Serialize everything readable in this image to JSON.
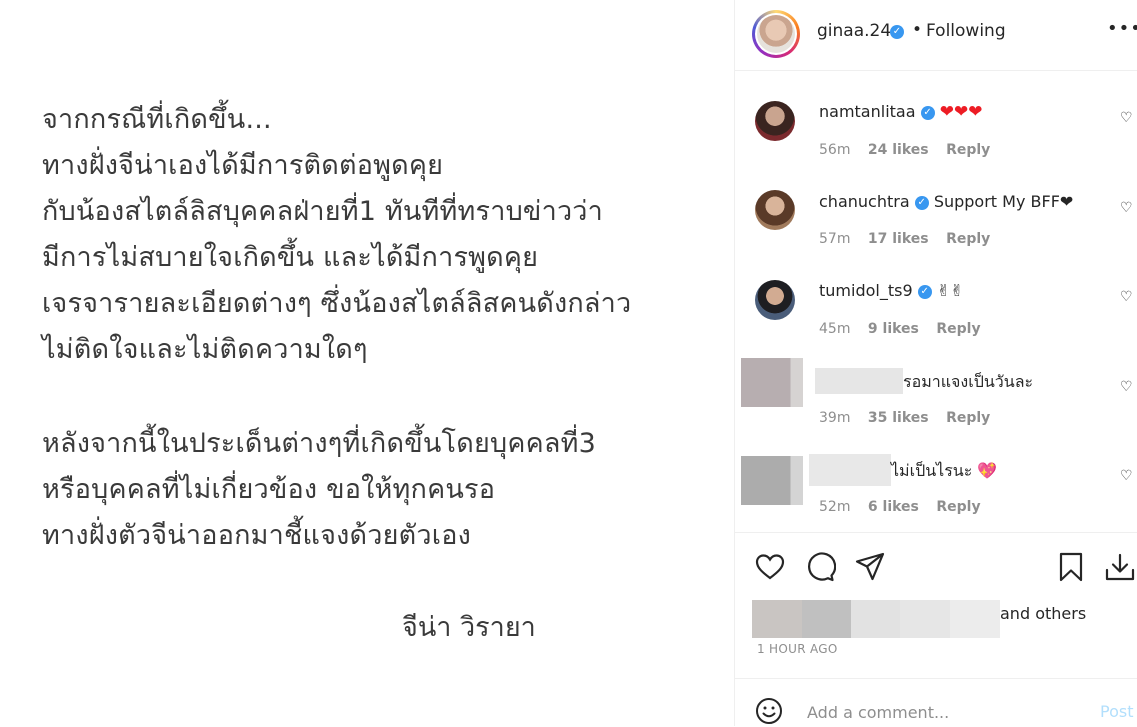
{
  "post": {
    "lines": [
      "จากกรณีที่เกิดขึ้น...",
      "ทางฝั่งจีน่าเองได้มีการติดต่อพูดคุย",
      "กับน้องสไตล์ลิสบุคคลฝ่ายที่1 ทันทีที่ทราบข่าวว่า",
      "มีการไม่สบายใจเกิดขึ้น และได้มีการพูดคุย",
      "เจรจารายละเอียดต่างๆ ซึ่งน้องสไตล์ลิสคนดังกล่าว",
      "ไม่ติดใจและไม่ติดความใดๆ",
      "หลังจากนี้ในประเด็นต่างๆที่เกิดขึ้นโดยบุคคลที่3",
      "หรือบุคคลที่ไม่เกี่ยวข้อง ขอให้ทุกคนรอ",
      "ทางฝั่งตัวจีน่าออกมาชี้แจงด้วยตัวเอง"
    ],
    "signature": "จีน่า วิรายา"
  },
  "header": {
    "username": "ginaa.24",
    "separator": "•",
    "following": "Following",
    "more": "•••"
  },
  "comments": [
    {
      "username": "namtanlitaa",
      "verified": true,
      "text": "❤❤❤",
      "time": "56m",
      "likes": "24 likes",
      "reply": "Reply"
    },
    {
      "username": "chanuchtra",
      "verified": true,
      "text": "Support My BFF❤",
      "time": "57m",
      "likes": "17 likes",
      "reply": "Reply"
    },
    {
      "username": "tumidol_ts9",
      "verified": true,
      "text": "✌✌",
      "time": "45m",
      "likes": "9 likes",
      "reply": "Reply"
    },
    {
      "username": "",
      "verified": false,
      "text": "รอมาแจงเป็นวันละ",
      "time": "39m",
      "likes": "35 likes",
      "reply": "Reply"
    },
    {
      "username": "",
      "verified": false,
      "text": "ไม่เป็นไรนะ 💖",
      "time": "52m",
      "likes": "6 likes",
      "reply": "Reply"
    }
  ],
  "actions": {
    "likes_text": "and others",
    "time": "1 HOUR AGO"
  },
  "add_comment": {
    "placeholder": "Add a comment...",
    "post_label": "Post"
  },
  "icons": {
    "like": "heart-icon",
    "comment": "comment-icon",
    "share": "send-icon",
    "save": "bookmark-icon",
    "download": "download-icon",
    "emoji": "smile-icon",
    "verified": "verified-badge-icon"
  },
  "colors": {
    "verified": "#3897f0",
    "heart_red": "#ed1c24",
    "meta_gray": "#8e8e8e",
    "post_disabled": "#b2dffc"
  }
}
